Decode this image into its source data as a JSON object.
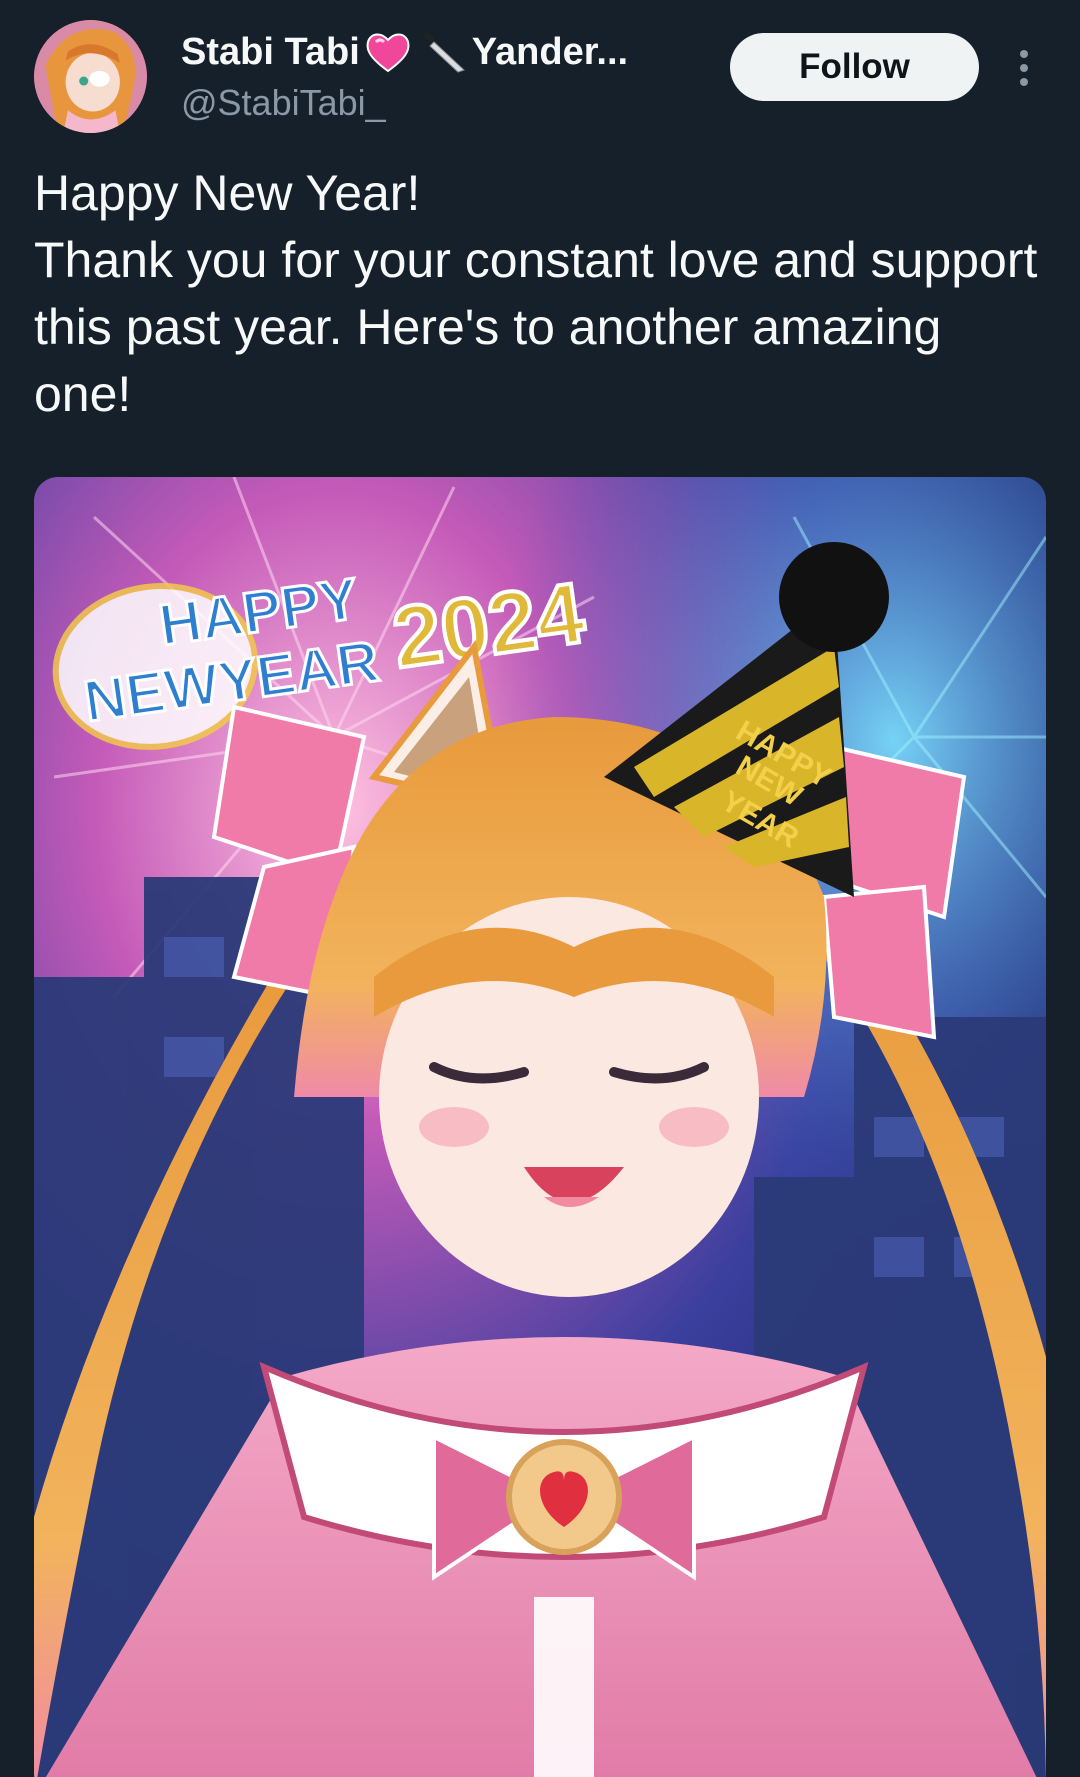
{
  "user": {
    "display_name": "Stabi Tabi",
    "display_name_suffix": "Yander...",
    "handle": "@StabiTabi_",
    "emoji_1": "pink-heart-icon",
    "emoji_2": "knife-icon"
  },
  "actions": {
    "follow_label": "Follow",
    "more_icon": "more-vertical-icon"
  },
  "tweet": {
    "lines": [
      "Happy New Year!",
      "Thank you for your constant love and support this past year. Here's to another amazing one!"
    ]
  },
  "media": {
    "banner_happy": "HAPPY",
    "banner_newyear": "NEWYEAR",
    "banner_year": "2024",
    "hat_line_1": "HAPPY",
    "hat_line_2": "NEW",
    "hat_line_3": "YEAR"
  },
  "colors": {
    "background": "#15202b",
    "text_primary": "#f7f9f9",
    "text_secondary": "#8b98a5",
    "follow_bg": "#eff3f4"
  }
}
